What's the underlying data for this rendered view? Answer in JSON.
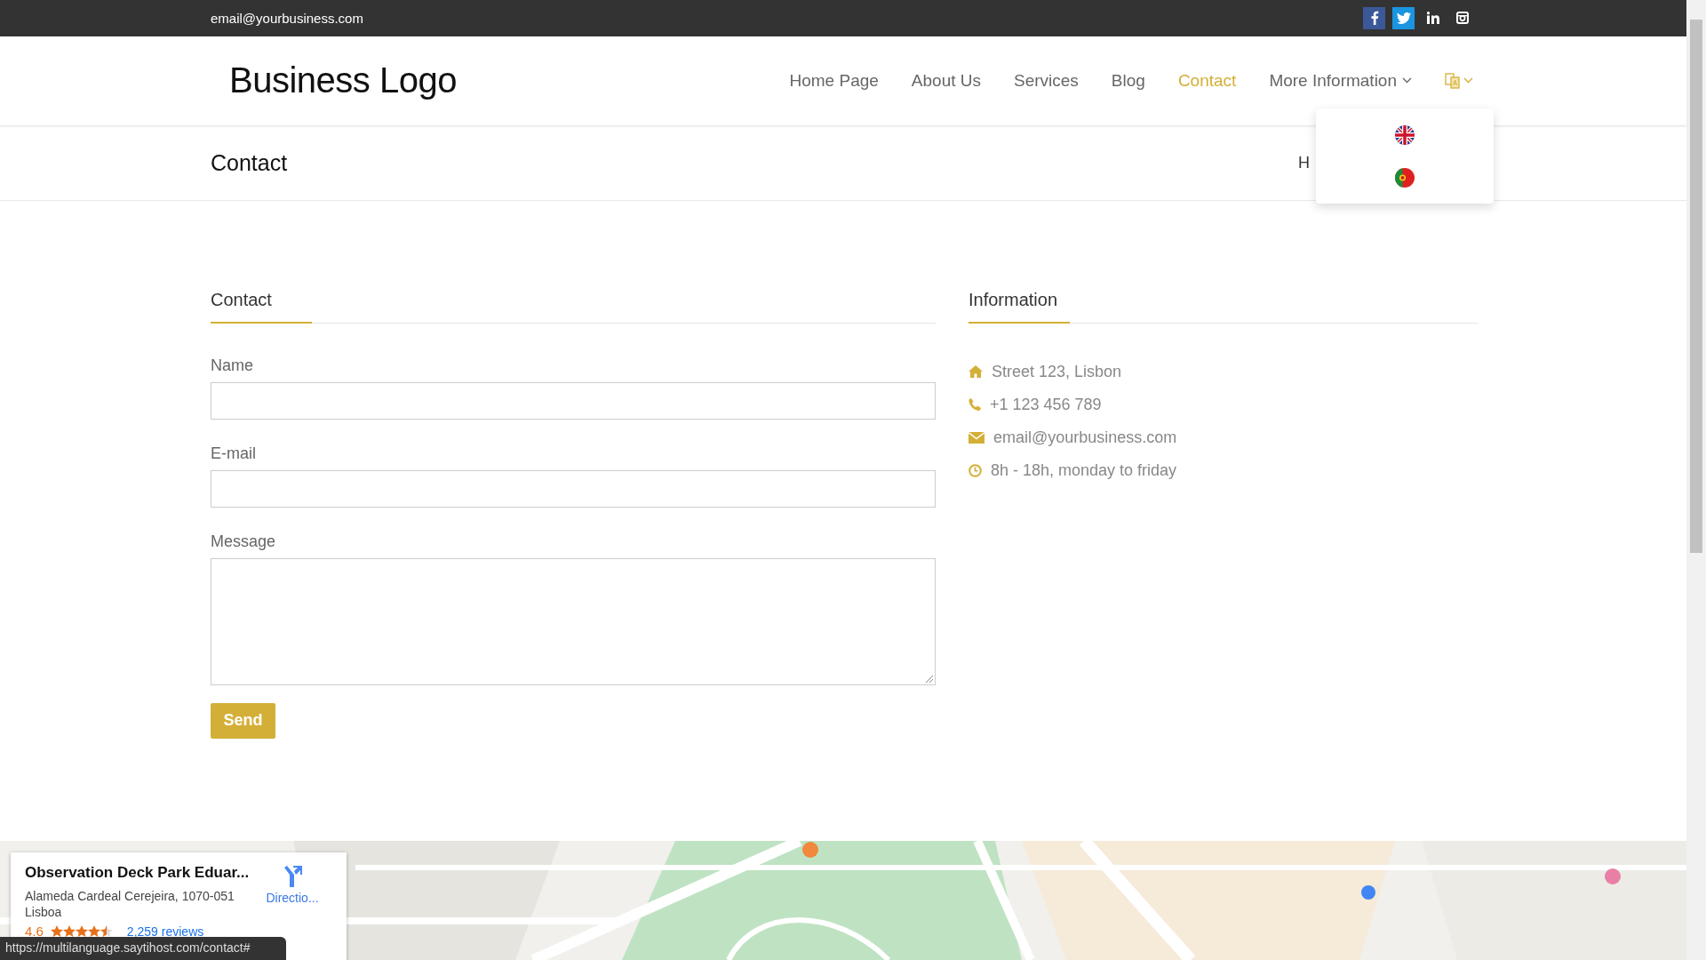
{
  "top_bar": {
    "email": "email@yourbusiness.com",
    "social": [
      {
        "kind": "facebook"
      },
      {
        "kind": "twitter"
      },
      {
        "kind": "linkedin"
      },
      {
        "kind": "instagram"
      }
    ]
  },
  "header": {
    "logo": "Business Logo",
    "nav": [
      {
        "label": "Home Page",
        "selected": false,
        "has_caret": false
      },
      {
        "label": "About Us",
        "selected": false,
        "has_caret": false
      },
      {
        "label": "Services",
        "selected": false,
        "has_caret": false
      },
      {
        "label": "Blog",
        "selected": false,
        "has_caret": false
      },
      {
        "label": "Contact",
        "selected": true,
        "has_caret": false
      },
      {
        "label": "More Information",
        "selected": false,
        "has_caret": true
      }
    ],
    "language_menu": {
      "expanded": true,
      "options": [
        {
          "kind": "uk"
        },
        {
          "kind": "portugal"
        }
      ]
    }
  },
  "page_title": {
    "title": "Contact",
    "breadcrumb": "H"
  },
  "contact_form": {
    "heading": "Contact",
    "fields": [
      {
        "label": "Name",
        "kind": "input"
      },
      {
        "label": "E-mail",
        "kind": "input"
      },
      {
        "label": "Message",
        "kind": "textarea"
      }
    ],
    "submit": "Send"
  },
  "information": {
    "heading": "Information",
    "items": [
      {
        "kind": "home",
        "text": "Street 123, Lisbon"
      },
      {
        "kind": "phone",
        "text": "+1 123 456 789"
      },
      {
        "kind": "mail",
        "text": "email@yourbusiness.com"
      },
      {
        "kind": "clock",
        "text": "8h - 18h, monday to friday"
      }
    ]
  },
  "map": {
    "place_card": {
      "title": "Observation Deck Park Eduar...",
      "address": "Alameda Cardeal Cerejeira, 1070-051 Lisboa",
      "rating": "4.6",
      "stars": 4.5,
      "reviews": "2,259 reviews",
      "directions": "Directio..."
    }
  },
  "status_bar": {
    "url": "https://multilanguage.saytihost.com/contact#"
  }
}
